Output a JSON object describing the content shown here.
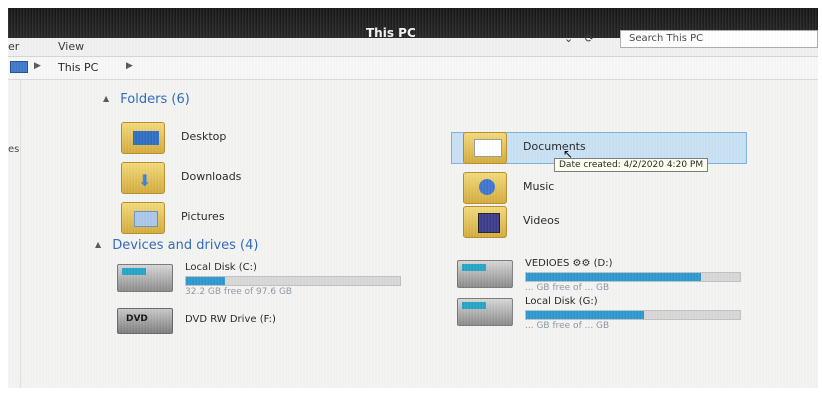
{
  "window": {
    "title": "This PC",
    "controls": "– □"
  },
  "ribbon": {
    "m1": "er",
    "m2": "View"
  },
  "address": {
    "crumb": "This PC",
    "search_placeholder": "Search This PC",
    "controls": [
      "⌄",
      "⟳"
    ]
  },
  "navpane": {
    "partial_label": "es"
  },
  "folders": {
    "header": "Folders (6)",
    "items": [
      {
        "name": "Desktop",
        "icon": "desktop-folder-icon"
      },
      {
        "name": "Downloads",
        "icon": "downloads-folder-icon"
      },
      {
        "name": "Pictures",
        "icon": "pictures-folder-icon"
      },
      {
        "name": "Documents",
        "icon": "documents-folder-icon"
      },
      {
        "name": "Music",
        "icon": "music-folder-icon"
      },
      {
        "name": "Videos",
        "icon": "videos-folder-icon"
      }
    ]
  },
  "tooltip": "Date created: 4/2/2020 4:20 PM",
  "devices": {
    "header": "Devices and drives (4)",
    "drives": [
      {
        "name": "Local Disk (C:)",
        "free_text": "32.2 GB free of 97.6 GB",
        "fill": 0.18
      },
      {
        "name": "DVD RW Drive (F:)",
        "free_text": "",
        "fill": 0
      },
      {
        "name": "VEDIOES ⚙⚙ (D:)",
        "free_text": "... GB free of ... GB",
        "fill": 0.82
      },
      {
        "name": "Local Disk (G:)",
        "free_text": "... GB free of ... GB",
        "fill": 0.55
      }
    ]
  },
  "colors": {
    "accent": "#2d66b7",
    "selected": "#c8e0f4",
    "bar": "#2b97cf"
  }
}
